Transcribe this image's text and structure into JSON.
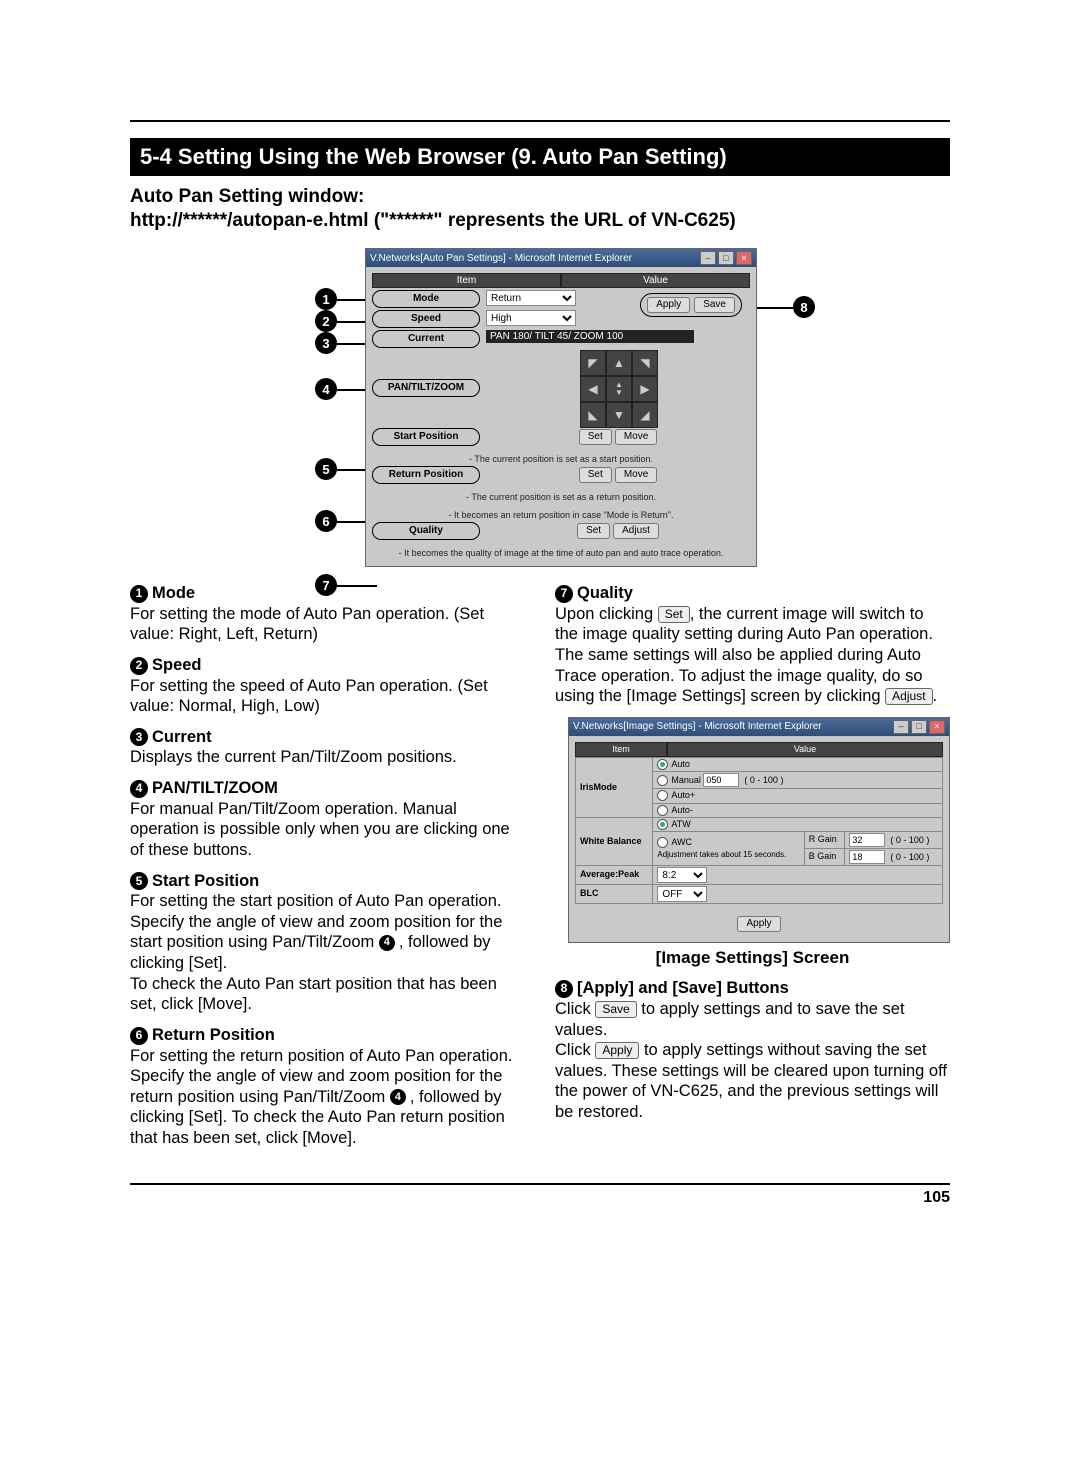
{
  "page_number": "105",
  "section_title": "5-4 Setting Using the Web Browser (9. Auto Pan Setting)",
  "subheading": "Auto Pan Setting window:",
  "url_line": "http://******/autopan-e.html (\"******\" represents the URL of VN-C625)",
  "main_window": {
    "title": "V.Networks[Auto Pan Settings] - Microsoft Internet Explorer",
    "header_item": "Item",
    "header_value": "Value",
    "rows": {
      "mode": {
        "label": "Mode",
        "value": "Return"
      },
      "speed": {
        "label": "Speed",
        "value": "High"
      },
      "current": {
        "label": "Current",
        "value": "PAN 180/ TILT 45/ ZOOM 100"
      },
      "ptz": {
        "label": "PAN/TILT/ZOOM"
      },
      "start": {
        "label": "Start Position",
        "btn_set": "Set",
        "btn_move": "Move",
        "note": "- The current position is set as a start position."
      },
      "return": {
        "label": "Return Position",
        "btn_set": "Set",
        "btn_move": "Move",
        "note1": "- The current position is set as a return position.",
        "note2": "- It becomes an return position in case \"Mode is Return\"."
      },
      "quality": {
        "label": "Quality",
        "btn_set": "Set",
        "btn_adjust": "Adjust",
        "note": "- It becomes the quality of image at the time of auto pan and auto trace operation."
      }
    },
    "apply": "Apply",
    "save": "Save"
  },
  "desc": {
    "d1": {
      "h": "Mode",
      "t": "For setting the mode of Auto Pan operation. (Set value: Right, Left, Return)"
    },
    "d2": {
      "h": "Speed",
      "t": "For setting the speed of Auto Pan operation. (Set value: Normal, High, Low)"
    },
    "d3": {
      "h": "Current",
      "t": "Displays the current Pan/Tilt/Zoom positions."
    },
    "d4": {
      "h": "PAN/TILT/ZOOM",
      "t": "For manual Pan/Tilt/Zoom operation. Manual operation is possible only when you are clicking one of these buttons."
    },
    "d5": {
      "h": "Start Position",
      "t1": "For setting the start position of Auto Pan operation. Specify the angle of view and zoom position for the start position using Pan/Tilt/Zoom ",
      "t2": ", followed by clicking [Set].",
      "t3": "To check the Auto Pan start position that has been set, click [Move]."
    },
    "d6": {
      "h": "Return Position",
      "t1": "For setting the return position of Auto Pan operation. Specify the angle of view and zoom position for the return position using Pan/Tilt/Zoom ",
      "t2": ", followed by clicking [Set]. To check the Auto Pan return position that has been set, click [Move]."
    },
    "d7": {
      "h": "Quality",
      "t1": "Upon clicking ",
      "btn1": "Set",
      "t2": ", the current image will switch to the image quality setting during Auto Pan operation.",
      "t3": "The same settings will also be applied during Auto Trace operation. To adjust the image quality, do so using the [Image Settings] screen by clicking ",
      "btn2": "Adjust",
      "t4": "."
    },
    "d8": {
      "h": "[Apply] and [Save] Buttons",
      "t1": "Click ",
      "btn1": "Save",
      "t2": " to apply settings and to save the set values.",
      "t3": "Click ",
      "btn2": "Apply",
      "t4": " to apply settings without saving the set values. These settings will be cleared upon turning off the power of VN-C625, and the previous settings will be restored."
    }
  },
  "img_settings": {
    "title": "V.Networks[Image Settings] - Microsoft Internet Explorer",
    "header_item": "Item",
    "header_value": "Value",
    "iris_label": "IrisMode",
    "iris": {
      "auto": "Auto",
      "manual": "Manual",
      "manual_val": "050",
      "manual_range": "( 0 - 100 )",
      "autop": "Auto+",
      "autom": "Auto-"
    },
    "wb_label": "White Balance",
    "wb": {
      "atw": "ATW",
      "awc": "AWC",
      "adjust_note": "Adjustment takes about 15 seconds.",
      "rgain": "R Gain",
      "rgain_val": "32",
      "rgain_range": "( 0 - 100 )",
      "bgain": "B Gain",
      "bgain_val": "18",
      "bgain_range": "( 0 - 100 )"
    },
    "avgpeak_label": "Average:Peak",
    "avgpeak_val": "8:2",
    "blc_label": "BLC",
    "blc_val": "OFF",
    "apply": "Apply",
    "caption": "[Image Settings] Screen"
  }
}
